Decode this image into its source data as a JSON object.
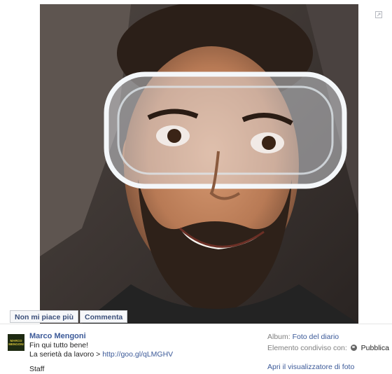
{
  "photo": {
    "actions": {
      "unlike_label": "Non mi piace più",
      "comment_label": "Commenta"
    }
  },
  "post": {
    "author": "Marco Mengoni",
    "avatar_text": [
      "MARCO",
      "MENGONI"
    ],
    "caption_line1": "Fin qui tutto bene!",
    "caption_line2_prefix": "La serietà da lavoro >",
    "caption_link": "http://goo.gl/qLMGHV",
    "signature": "Staff"
  },
  "meta": {
    "album_label": "Album:",
    "album_value": "Foto del diario",
    "shared_label": "Elemento condiviso con:",
    "shared_value": "Pubblica",
    "viewer_link": "Apri il visualizzatore di foto"
  },
  "colors": {
    "link": "#3b5998",
    "button_bg": "#f6f7f9"
  },
  "icons": {
    "expand": "expand-icon",
    "privacy": "globe-icon"
  }
}
